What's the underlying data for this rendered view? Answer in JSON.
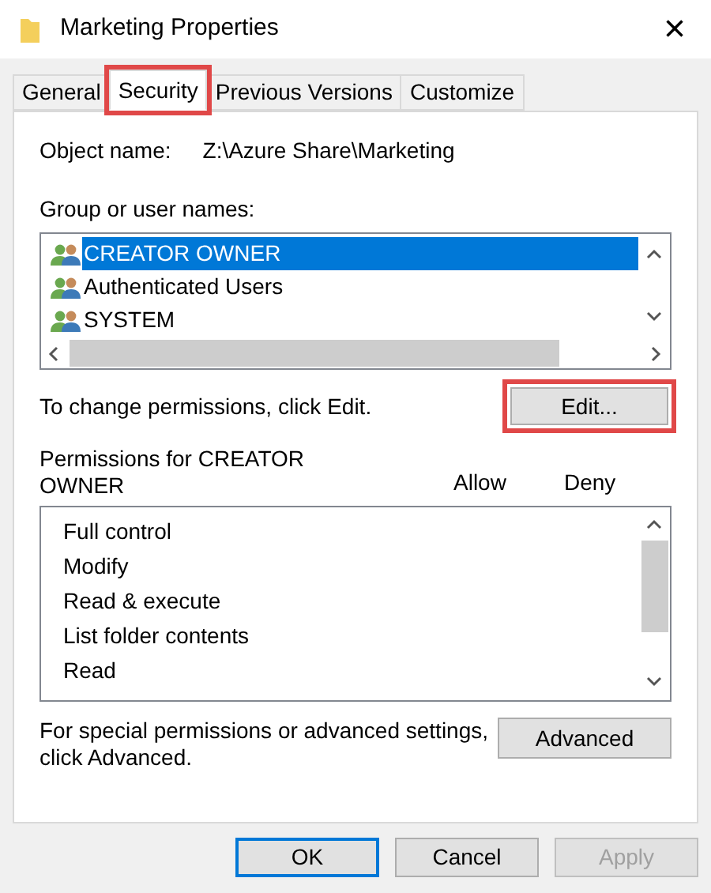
{
  "window": {
    "title": "Marketing Properties",
    "close": "×"
  },
  "tabs": [
    {
      "label": "General",
      "selected": false,
      "highlighted": false
    },
    {
      "label": "Security",
      "selected": true,
      "highlighted": true
    },
    {
      "label": "Previous Versions",
      "selected": false,
      "highlighted": false
    },
    {
      "label": "Customize",
      "selected": false,
      "highlighted": false
    }
  ],
  "object_name": {
    "label": "Object name:",
    "value": "Z:\\Azure Share\\Marketing"
  },
  "groups": {
    "label": "Group or user names:",
    "items": [
      {
        "name": "CREATOR OWNER",
        "selected": true
      },
      {
        "name": "Authenticated Users",
        "selected": false
      },
      {
        "name": "SYSTEM",
        "selected": false
      }
    ]
  },
  "change_hint": "To change permissions, click Edit.",
  "edit_button": {
    "label": "Edit...",
    "highlighted": true
  },
  "permissions": {
    "label": "Permissions for CREATOR OWNER",
    "columns": [
      "Allow",
      "Deny"
    ],
    "items": [
      {
        "name": "Full control"
      },
      {
        "name": "Modify"
      },
      {
        "name": "Read & execute"
      },
      {
        "name": "List folder contents"
      },
      {
        "name": "Read"
      }
    ]
  },
  "advanced_hint": "For special permissions or advanced settings, click Advanced.",
  "advanced_button": "Advanced",
  "buttons": [
    {
      "label": "OK",
      "default": true,
      "disabled": false
    },
    {
      "label": "Cancel",
      "default": false,
      "disabled": false
    },
    {
      "label": "Apply",
      "default": false,
      "disabled": true
    }
  ]
}
